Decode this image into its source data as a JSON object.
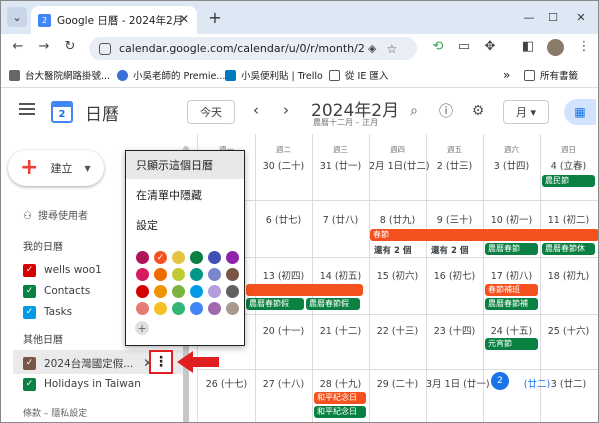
{
  "browser": {
    "tab_title": "Google 日曆 - 2024年2月",
    "tab_icon_text": "2",
    "new_tab": "+",
    "url": "calendar.google.com/calendar/u/0/r/month/2024...",
    "bookmarks": [
      {
        "label": "台大醫院網路掛號..."
      },
      {
        "label": "小吳老師的 Premie..."
      },
      {
        "label": "小吳便利貼 | Trello"
      },
      {
        "label": "從 IE 匯入"
      }
    ],
    "more_bookmarks": "»",
    "all_bookmarks": "所有書籤"
  },
  "header": {
    "app_name": "日曆",
    "logo_text": "2",
    "today_button": "今天",
    "prev": "‹",
    "next": "›",
    "month_title": "2024年2月",
    "lunar_subtitle": "農曆十二月 – 正月",
    "view_button": "月 ▾"
  },
  "sidebar": {
    "create_label": "建立",
    "search_people": "搜尋使用者",
    "my_calendars_title": "我的日曆",
    "my_calendars": [
      {
        "label": "wells woo1",
        "color": "#d50000"
      },
      {
        "label": "Contacts",
        "color": "#0b8043"
      },
      {
        "label": "Tasks",
        "color": "#039be5"
      }
    ],
    "other_calendars_title": "其他日曆",
    "other_calendars": [
      {
        "label": "2024台灣國定假...",
        "color": "#795548"
      },
      {
        "label": "Holidays in Taiwan",
        "color": "#0b8043"
      }
    ],
    "hide_x": "✕",
    "footer": "條款 – 隱私設定"
  },
  "options_menu": {
    "items": [
      "只顯示這個日曆",
      "在清單中隱藏",
      "設定"
    ],
    "add_color": "+",
    "colors": [
      "#ad1457",
      "#f4511e",
      "#e4c441",
      "#0b8043",
      "#3f51b5",
      "#8e24aa",
      "#d81b60",
      "#ef6c00",
      "#c0ca33",
      "#009688",
      "#7986cb",
      "#795548",
      "#d50000",
      "#f09300",
      "#7cb342",
      "#039be5",
      "#b39ddb",
      "#616161",
      "#e67c73",
      "#f6bf26",
      "#33b679",
      "#4285f4",
      "#9e69af",
      "#a79b8e"
    ],
    "selected_color": "#f4511e"
  },
  "grid": {
    "weekdays": [
      "週一",
      "週二",
      "週三",
      "週四",
      "週五",
      "週六",
      "週日"
    ],
    "weeks": [
      [
        "",
        "30 (二十)",
        "31 (廿一)",
        "2月 1日(廿二)",
        "2 (廿三)",
        "3 (廿四)",
        "4 (立春)"
      ],
      [
        "",
        "6 (廿七)",
        "7 (廿八)",
        "8 (廿九)",
        "9 (三十)",
        "10 (初一)",
        "11 (初二)"
      ],
      [
        "",
        "13 (初四)",
        "14 (初五)",
        "15 (初六)",
        "16 (初七)",
        "17 (初八)",
        "18 (初九)"
      ],
      [
        "",
        "20 (十一)",
        "21 (十二)",
        "22 (十三)",
        "23 (十四)",
        "24 (十五)",
        "25 (十六)"
      ],
      [
        "26 (十七)",
        "27 (十八)",
        "28 (十九)",
        "29 (二十)",
        "3月 1日 (廿一)",
        "2",
        "3 (廿二)"
      ]
    ],
    "today_suffix": "(廿二)",
    "events": {
      "spring_festival": "春節",
      "more1": "還有 2 個",
      "more2": "還有 2 個",
      "farmer_sat": "農曆春節",
      "farmer_sun": "農曆春節休",
      "farmer_w3a": "農曆春節假",
      "farmer_w3b": "農曆春節假",
      "make_up": "春節補班",
      "farmer_w3c": "農曆春節補",
      "farmers_day": "農民節",
      "lantern": "元宵節",
      "peace1": "和平紀念日",
      "peace2": "和平紀念日"
    },
    "event_colors": {
      "teal": "#0b8043",
      "orange": "#f4511e"
    }
  }
}
